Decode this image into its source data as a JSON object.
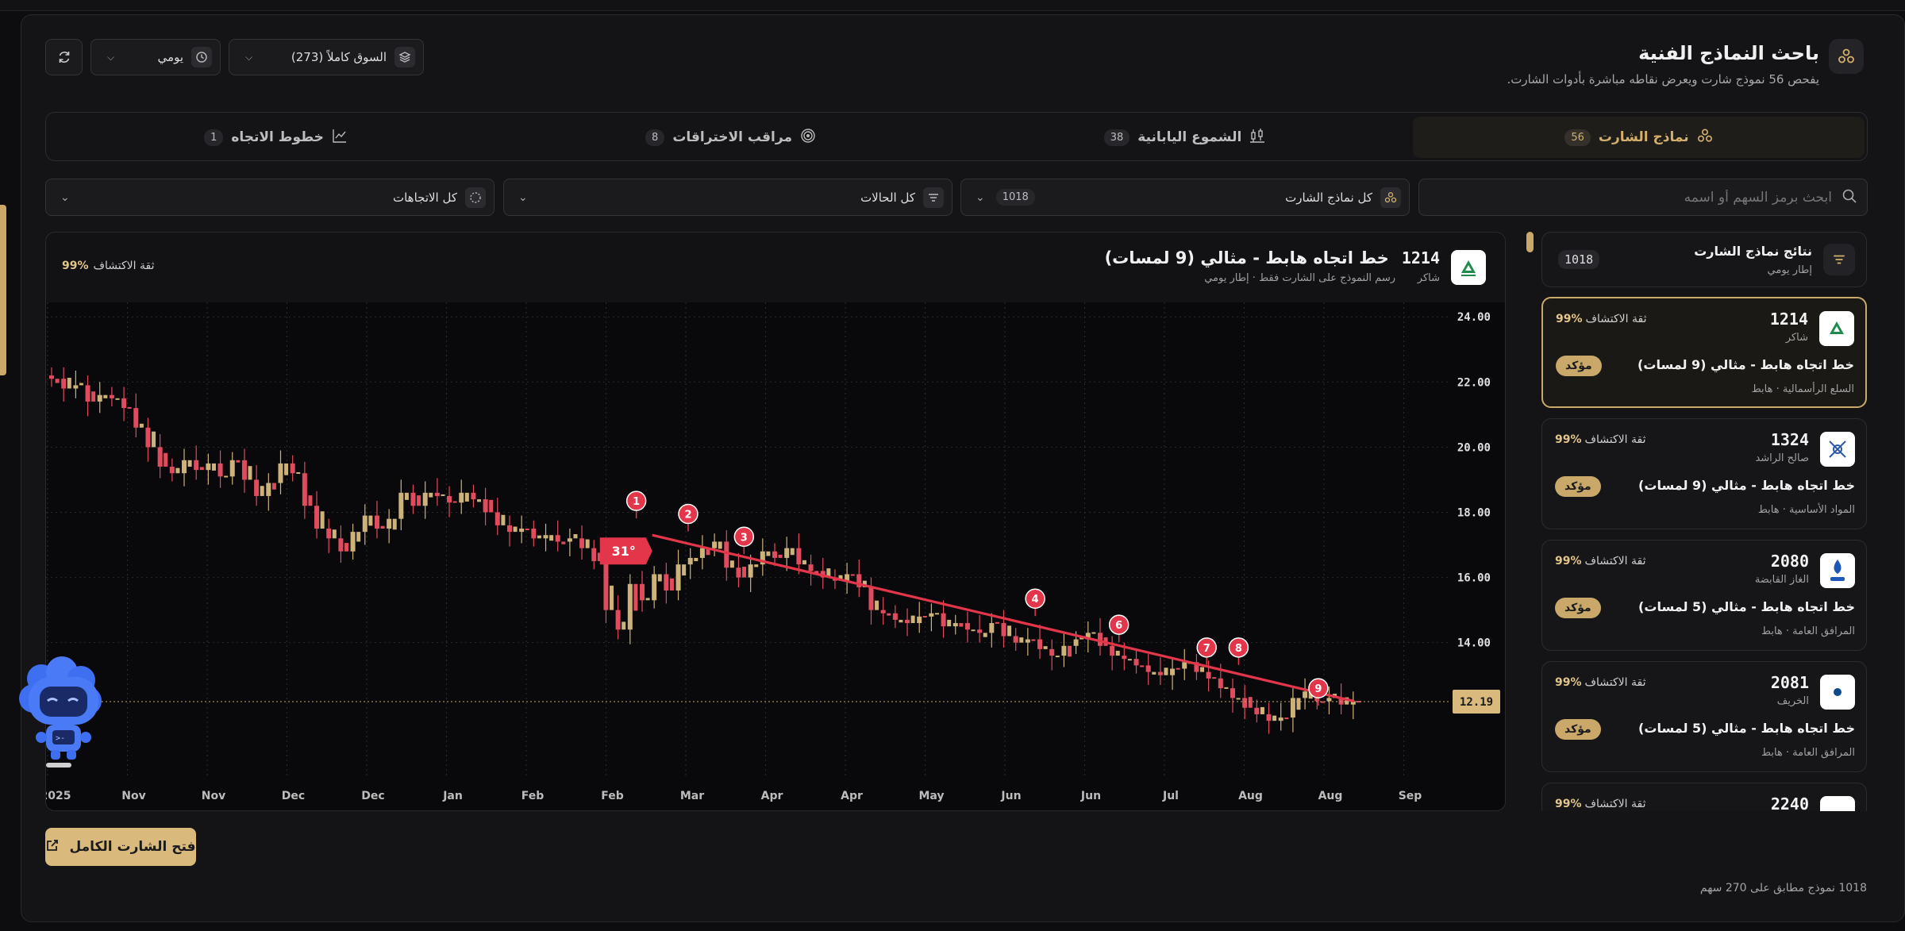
{
  "header": {
    "title": "باحث النماذج الفنية",
    "subtitle": "يفحص 56 نموذج شارت ويعرض نقاطه مباشرة بأدوات الشارت.",
    "market_select": "السوق كاملاً (273)",
    "timeframe_select": "يومي"
  },
  "tabs": [
    {
      "label": "نماذج الشارت",
      "count": "56",
      "icon": "pattern-icon",
      "active": true
    },
    {
      "label": "الشموع اليابانية",
      "count": "38",
      "icon": "candles-icon",
      "active": false
    },
    {
      "label": "مراقب الاختراقات",
      "count": "8",
      "icon": "target-icon",
      "active": false
    },
    {
      "label": "خطوط الاتجاه",
      "count": "1",
      "icon": "trend-line-icon",
      "active": false
    }
  ],
  "filters": {
    "search_placeholder": "ابحث برمز السهم أو اسمه",
    "patterns_label": "كل نماذج الشارت",
    "patterns_count": "1018",
    "states_label": "كل الحالات",
    "directions_label": "كل الاتجاهات"
  },
  "chart": {
    "symbol": "1214",
    "pattern_title": "خط اتجاه هابط - مثالي (9 لمسات)",
    "company": "شاكر",
    "meta": "رسم النموذج على الشارت فقط · إطار يومي",
    "confidence_label": "ثقة الاكتشاف",
    "confidence_value": "99%",
    "angle_label": "31°",
    "price_label": "12.19",
    "colors": {
      "up": "#cdb27a",
      "down": "#e04b5e",
      "trend": "#e3364a",
      "accent": "#c9a86a"
    }
  },
  "chart_data": {
    "type": "candlestick",
    "y_ticks": [
      "24.00",
      "22.00",
      "20.00",
      "18.00",
      "16.00",
      "14.00"
    ],
    "ylim": [
      10.8,
      24.2
    ],
    "x_ticks": [
      "2025",
      "Nov",
      "Nov",
      "Dec",
      "Dec",
      "Jan",
      "Feb",
      "Feb",
      "Mar",
      "Apr",
      "Apr",
      "May",
      "Jun",
      "Jun",
      "Jul",
      "Aug",
      "Aug",
      "Sep"
    ],
    "current_price": 12.19,
    "close_series": [
      22.1,
      21.8,
      21.9,
      21.4,
      21.6,
      21.5,
      21.2,
      20.6,
      20.0,
      19.4,
      19.2,
      19.6,
      19.3,
      19.5,
      19.1,
      19.6,
      19.0,
      18.5,
      18.9,
      19.5,
      19.2,
      18.2,
      17.5,
      17.2,
      16.8,
      17.4,
      17.9,
      17.5,
      17.8,
      18.6,
      18.2,
      18.6,
      18.5,
      18.3,
      18.6,
      18.4,
      18.0,
      17.6,
      17.4,
      17.5,
      17.2,
      17.3,
      17.1,
      17.2,
      16.9,
      16.5,
      15.0,
      14.4,
      15.8,
      15.3,
      16.1,
      15.6,
      16.4,
      16.6,
      16.9,
      17.1,
      16.3,
      16.0,
      16.4,
      16.8,
      16.6,
      16.9,
      16.4,
      16.2,
      16.0,
      15.9,
      16.1,
      15.7,
      15.0,
      14.9,
      14.7,
      14.6,
      14.8,
      14.9,
      14.5,
      14.6,
      14.4,
      14.3,
      14.6,
      14.2,
      14.0,
      14.1,
      13.8,
      13.6,
      13.9,
      14.1,
      14.3,
      13.9,
      13.6,
      13.5,
      13.3,
      13.1,
      13.0,
      13.2,
      13.4,
      13.1,
      12.9,
      12.6,
      12.3,
      12.0,
      11.8,
      11.6,
      11.7,
      12.3,
      12.5,
      12.2,
      12.3,
      12.1,
      12.2
    ],
    "trendline": {
      "start": [
        7.5,
        17.3
      ],
      "end": [
        16.3,
        12.2
      ]
    },
    "touch_points": [
      {
        "n": "1",
        "x_month": 7.3,
        "price": 18.35
      },
      {
        "n": "2",
        "x_month": 7.95,
        "price": 17.95
      },
      {
        "n": "3",
        "x_month": 8.65,
        "price": 17.25
      },
      {
        "n": "4",
        "x_month": 12.3,
        "price": 15.35
      },
      {
        "n": "6",
        "x_month": 13.35,
        "price": 14.55
      },
      {
        "n": "7",
        "x_month": 14.45,
        "price": 13.85
      },
      {
        "n": "8",
        "x_month": 14.85,
        "price": 13.85
      },
      {
        "n": "9",
        "x_month": 15.85,
        "price": 12.6
      }
    ]
  },
  "results": {
    "title": "نتائج نماذج الشارت",
    "subtitle": "إطار يومي",
    "count": "1018",
    "items": [
      {
        "code": "1214",
        "company": "شاكر",
        "pattern": "خط اتجاه هابط - مثالي (9 لمسات)",
        "sector": "السلع الرأسمالية · هابط",
        "confidence_label": "ثقة الاكتشاف",
        "confidence": "99%",
        "status": "مؤكد",
        "logo_icon": "shaker-logo-icon"
      },
      {
        "code": "1324",
        "company": "صالح الراشد",
        "pattern": "خط اتجاه هابط - مثالي (9 لمسات)",
        "sector": "المواد الأساسية · هابط",
        "confidence_label": "ثقة الاكتشاف",
        "confidence": "99%",
        "status": "مؤكد",
        "logo_icon": "alrashed-logo-icon"
      },
      {
        "code": "2080",
        "company": "الغاز القابضة",
        "pattern": "خط اتجاه هابط - مثالي (5 لمسات)",
        "sector": "المرافق العامة · هابط",
        "confidence_label": "ثقة الاكتشاف",
        "confidence": "99%",
        "status": "مؤكد",
        "logo_icon": "gasco-logo-icon"
      },
      {
        "code": "2081",
        "company": "الخريف",
        "pattern": "خط اتجاه هابط - مثالي (5 لمسات)",
        "sector": "المرافق العامة · هابط",
        "confidence_label": "ثقة الاكتشاف",
        "confidence": "99%",
        "status": "مؤكد",
        "logo_icon": "alkhorayef-logo-icon"
      },
      {
        "code": "2240",
        "confidence_label": "ثقة الاكتشاف",
        "confidence": "99%",
        "logo_icon": "company-logo-icon"
      }
    ]
  },
  "actions": {
    "open_full_chart": "فتح الشارت الكامل"
  },
  "footer": {
    "summary": "1018 نموذج مطابق على 270 سهم"
  }
}
